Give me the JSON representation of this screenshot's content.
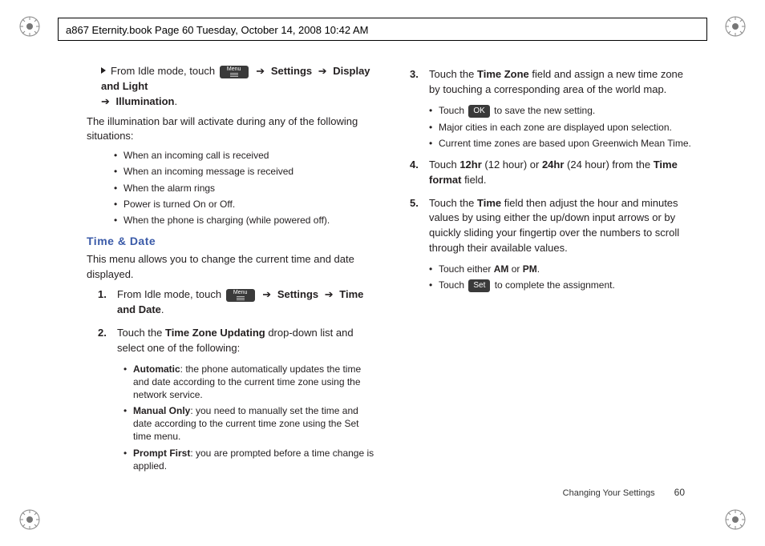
{
  "crop_header": "a867 Eternity.book  Page 60  Tuesday, October 14, 2008  10:42 AM",
  "ui": {
    "menu_label": "Menu",
    "ok_label": "OK",
    "set_label": "Set",
    "arrow": "➔"
  },
  "left": {
    "intro_prefix": "From Idle mode, touch ",
    "intro_settings": "Settings",
    "intro_display": "Display and Light",
    "intro_illum": "Illumination",
    "intro_period": ".",
    "illum_para": "The illumination bar will activate during any of the following situations:",
    "illum_bullets": [
      "When an incoming call is received",
      "When an incoming message is received",
      "When the alarm rings",
      "Power is turned On or Off.",
      "When the phone is charging (while powered off)."
    ],
    "section_head": "Time & Date",
    "section_intro": "This menu allows you to change the current time and date displayed.",
    "step1_prefix": "From Idle mode, touch ",
    "step1_settings": "Settings",
    "step1_timedate": "Time and Date",
    "step1_period": ".",
    "step2_a": "Touch the ",
    "step2_b": "Time Zone Updating",
    "step2_c": " drop-down list and select one of the following:",
    "tz_options": [
      {
        "label": "Automatic",
        "desc": ": the phone automatically updates the time and date according to the current time zone using the network service."
      },
      {
        "label": "Manual Only",
        "desc": ": you need to manually set the time and date according to the current time zone using the Set time menu."
      },
      {
        "label": "Prompt First",
        "desc": ": you are prompted before a time change is applied."
      }
    ]
  },
  "right": {
    "step3_a": "Touch the ",
    "step3_b": "Time Zone",
    "step3_c": " field and assign a new time zone by touching a corresponding area of the world map.",
    "step3_sub1_a": "Touch ",
    "step3_sub1_b": " to save the new setting.",
    "step3_sub2": "Major cities in each zone are displayed upon selection.",
    "step3_sub3": "Current time zones are based upon Greenwich Mean Time.",
    "step4_a": "Touch ",
    "step4_b": "12hr",
    "step4_c": " (12 hour) or ",
    "step4_d": "24hr",
    "step4_e": " (24 hour) from the ",
    "step4_f": "Time format",
    "step4_g": " field.",
    "step5_a": "Touch the ",
    "step5_b": "Time",
    "step5_c": " field then adjust the hour and minutes values by using either the up/down input arrows or by quickly sliding your fingertip over the numbers to scroll through their available values.",
    "step5_sub1_a": "Touch either ",
    "step5_sub1_b": "AM",
    "step5_sub1_c": " or ",
    "step5_sub1_d": "PM",
    "step5_sub1_e": ".",
    "step5_sub2_a": "Touch ",
    "step5_sub2_b": " to complete the assignment."
  },
  "footer": {
    "section": "Changing Your Settings",
    "page": "60"
  }
}
